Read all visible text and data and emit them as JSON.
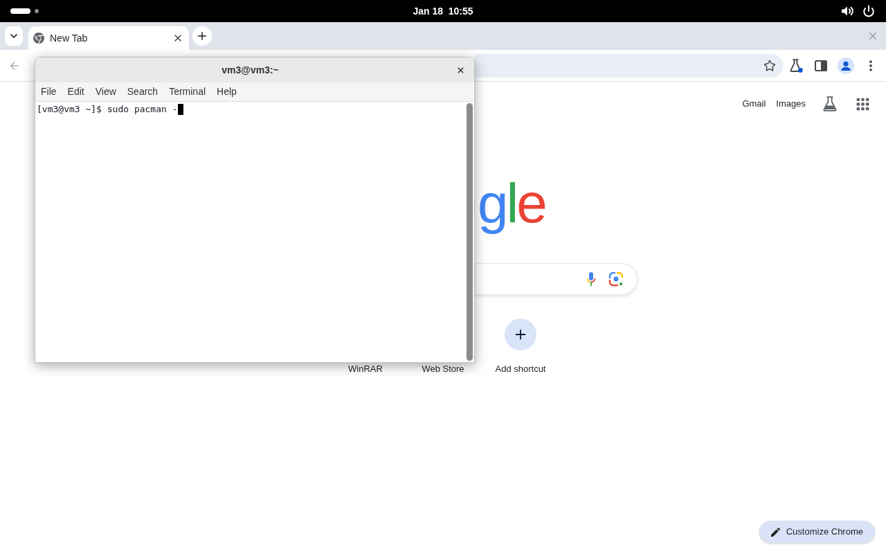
{
  "top_bar": {
    "clock": "Jan 18  10:55"
  },
  "browser": {
    "tabs": [
      {
        "title": "New Tab",
        "selected": true
      }
    ],
    "new_tab_page": {
      "header_links": [
        "Gmail",
        "Images"
      ],
      "logo": "gle",
      "shortcuts": [
        {
          "kind": "site",
          "label": "WinRAR"
        },
        {
          "kind": "site",
          "label": "Web Store"
        },
        {
          "kind": "add",
          "label": "Add shortcut"
        }
      ],
      "customize_button": "Customize Chrome"
    }
  },
  "terminal": {
    "title": "vm3@vm3:~",
    "menu": [
      "File",
      "Edit",
      "View",
      "Search",
      "Terminal",
      "Help"
    ],
    "lines": [
      "[vm3@vm3 ~]$ sudo pacman -"
    ],
    "cursor_visible": true
  }
}
